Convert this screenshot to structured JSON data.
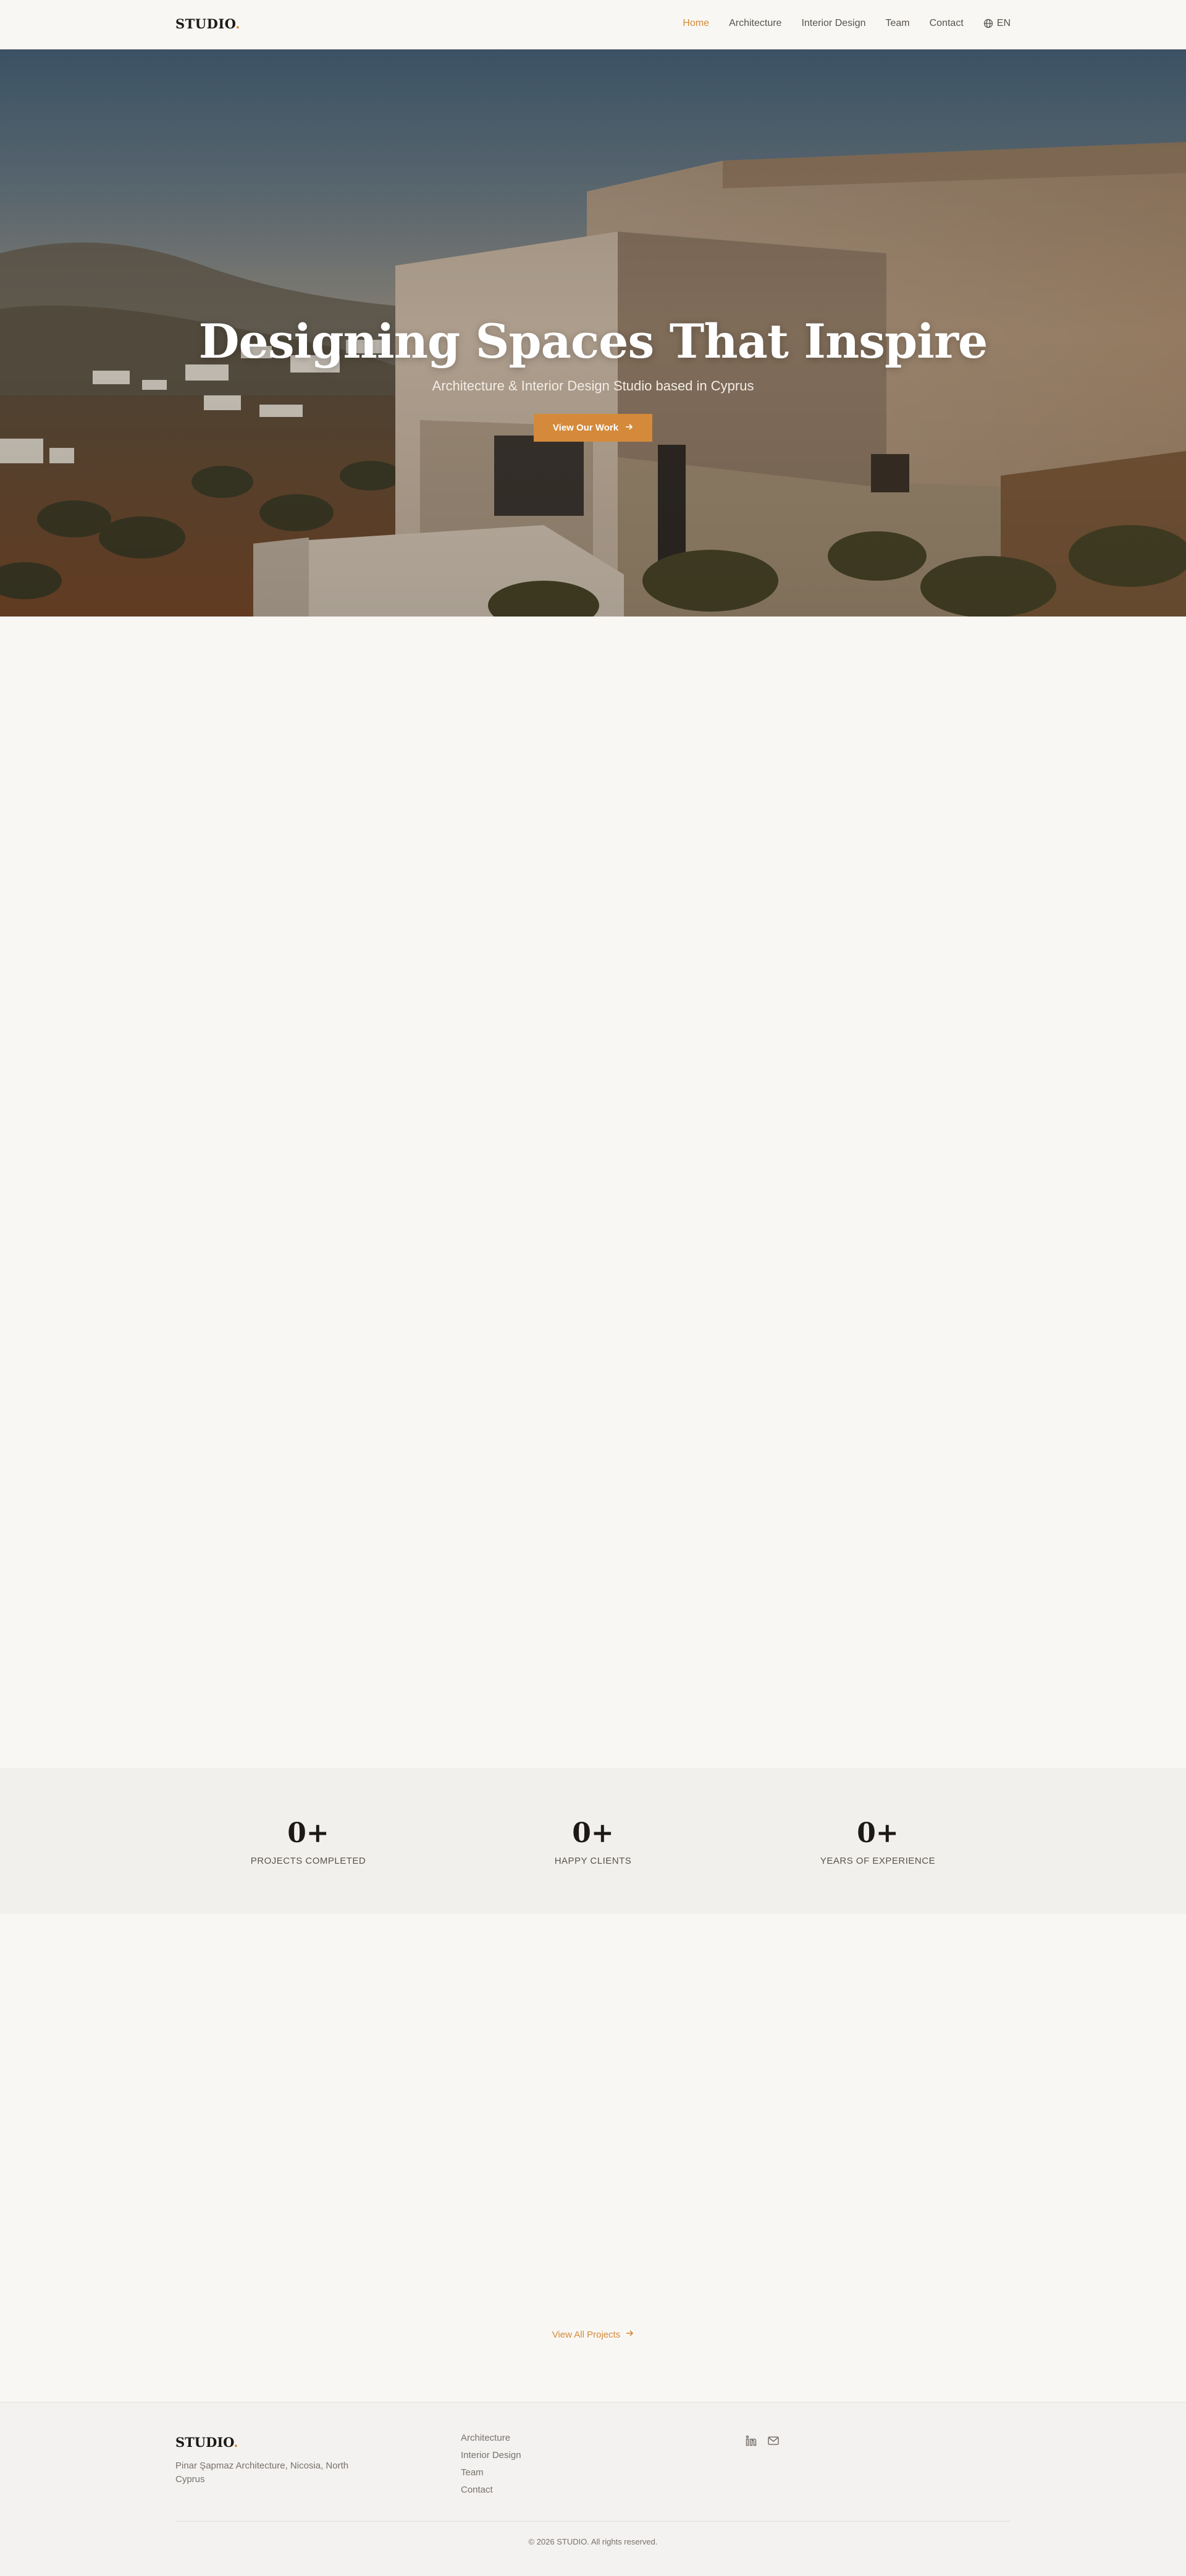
{
  "nav": {
    "logo_text": "STUDIO",
    "logo_dot": ".",
    "links": [
      "Home",
      "Architecture",
      "Interior Design",
      "Team",
      "Contact"
    ],
    "active_link": "Home",
    "language": "EN",
    "language_icon": "globe-icon"
  },
  "hero": {
    "title": "Designing Spaces That Inspire",
    "subtitle": "Architecture & Interior Design Studio based in Cyprus",
    "cta_label": "View Our Work",
    "cta_icon": "arrow-right-icon"
  },
  "stats": [
    {
      "value": "0+",
      "label": "PROJECTS COMPLETED"
    },
    {
      "value": "0+",
      "label": "HAPPY CLIENTS"
    },
    {
      "value": "0+",
      "label": "YEARS OF EXPERIENCE"
    }
  ],
  "projects": {
    "view_all_label": "View All Projects"
  },
  "footer": {
    "logo_text": "STUDIO",
    "logo_dot": ".",
    "address": "Pinar Şapmaz Architecture, Nicosia, North Cyprus",
    "links": [
      "Architecture",
      "Interior Design",
      "Team",
      "Contact"
    ],
    "social_icons": [
      "linkedin-icon",
      "mail-icon"
    ],
    "copyright": "© 2026 STUDIO. All rights reserved."
  },
  "colors": {
    "accent": "#d48a3a",
    "background": "#f9f7f4",
    "stats_background": "#f2f0ec",
    "footer_background": "#f3f2f0",
    "text": "#1c1917",
    "muted": "#78716c"
  }
}
